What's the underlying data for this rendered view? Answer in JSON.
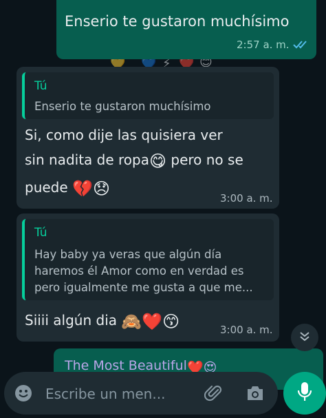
{
  "wallpaper_emojis": [
    "💛",
    "💙",
    "⚡",
    "❤️",
    "😊"
  ],
  "messages": [
    {
      "text": "Enserio te gustaron muchísimo",
      "time": "2:57 a. m.",
      "status": "double-check-read"
    },
    {
      "reply_author": "Tú",
      "reply_text": "Enserio te gustaron muchísimo",
      "line1": "Si,  como dije las quisiera ver",
      "line2": "sin nadita de ropa",
      "emoji_a": "😋",
      "line2_end": "pero no se",
      "line3": "puede",
      "emoji_b": "💔",
      "emoji_c": "😞",
      "time": "3:00 a. m."
    },
    {
      "reply_author": "Tú",
      "reply_lines": [
        "Hay baby ya veras que algún día",
        "haremos él Amor como en verdad es",
        "pero igualmente me gusta a que me..."
      ],
      "text": "Siiii algún dia",
      "emoji_a": "🙈",
      "emoji_b": "❤️",
      "emoji_c": "😙",
      "time": "3:00 a. m."
    },
    {
      "text": "The Most Beautiful",
      "emojis": "❤️😍"
    }
  ],
  "scroll_button": {
    "icon": "double-chevron-down-icon",
    "glyph": "⌄"
  },
  "composer": {
    "placeholder": "Escribe un men...",
    "icons": [
      "emoji-icon",
      "attach-icon",
      "camera-icon",
      "mic-icon"
    ]
  },
  "colors": {
    "background": "#0b141a",
    "outgoing_bubble": "#075e4f",
    "incoming_bubble": "#1f2c33",
    "accent": "#00a884",
    "read_ticks": "#53bdeb"
  }
}
